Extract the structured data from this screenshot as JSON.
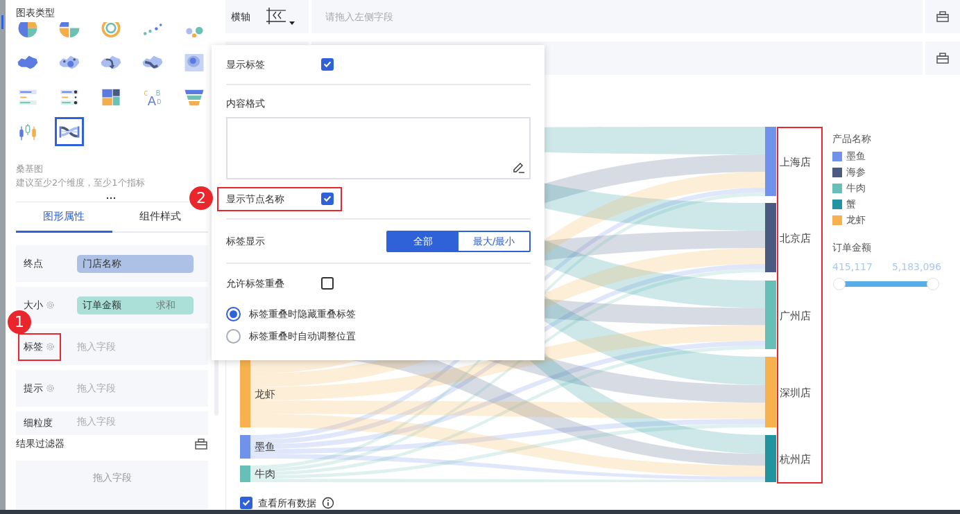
{
  "left_panel": {
    "title": "图表类型",
    "chart_types": [
      {
        "kind": "pie",
        "selected": false
      },
      {
        "kind": "half-pie",
        "selected": false
      },
      {
        "kind": "ring",
        "selected": false
      },
      {
        "kind": "dots",
        "selected": false
      },
      {
        "kind": "bubbles",
        "selected": false
      },
      {
        "kind": "map",
        "selected": false
      },
      {
        "kind": "bubble-map",
        "selected": false
      },
      {
        "kind": "flow-map",
        "selected": false
      },
      {
        "kind": "point-map",
        "selected": false
      },
      {
        "kind": "heat-map",
        "selected": false
      },
      {
        "kind": "rank-list",
        "selected": false
      },
      {
        "kind": "rank-dots",
        "selected": false
      },
      {
        "kind": "treemap",
        "selected": false
      },
      {
        "kind": "word-cloud",
        "letters": [
          "C",
          "A",
          "B",
          "D"
        ],
        "selected": false
      },
      {
        "kind": "funnel",
        "selected": false
      },
      {
        "kind": "candlestick",
        "selected": false
      },
      {
        "kind": "sankey",
        "selected": true
      }
    ],
    "chart_name": "桑基图",
    "chart_hint": "建议至少2个维度，至少1个指标",
    "tabs": [
      {
        "label": "图形属性",
        "selected": true
      },
      {
        "label": "组件样式",
        "selected": false
      }
    ],
    "fields": [
      {
        "label": "终点",
        "settings": false,
        "kind": "dimension",
        "value": "门店名称",
        "highlighted": false
      },
      {
        "label": "大小",
        "settings": true,
        "kind": "measure",
        "value": "订单金额",
        "aggregate": "求和",
        "highlighted": false
      },
      {
        "label": "标签",
        "settings": true,
        "kind": "empty",
        "placeholder": "拖入字段",
        "highlighted": true,
        "badge": "1"
      },
      {
        "label": "提示",
        "settings": true,
        "kind": "empty",
        "placeholder": "拖入字段",
        "highlighted": false
      },
      {
        "label": "细粒度",
        "settings": false,
        "kind": "empty",
        "placeholder": "拖入字段",
        "highlighted": false
      }
    ],
    "result_filter": {
      "title": "结果过滤器",
      "placeholder": "拖入字段"
    }
  },
  "axis_bar": {
    "label": "横轴",
    "placeholder": "请拖入左侧字段"
  },
  "chart": {
    "source_nodes": [
      {
        "label": "龙虾",
        "color": "#f7b24f"
      },
      {
        "label": "墨鱼",
        "color": "#7092ea"
      },
      {
        "label": "牛肉",
        "color": "#68bfb7"
      }
    ],
    "target_nodes": [
      {
        "label": "上海店",
        "color": "#7092ea"
      },
      {
        "label": "北京店",
        "color": "#4a5a80"
      },
      {
        "label": "广州店",
        "color": "#68bfb7"
      },
      {
        "label": "深圳店",
        "color": "#f7b24f"
      },
      {
        "label": "杭州店",
        "color": "#21949f"
      }
    ],
    "target_labels_highlighted": true,
    "legend": {
      "title": "产品名称",
      "items": [
        {
          "label": "墨鱼",
          "color": "#7092ea"
        },
        {
          "label": "海参",
          "color": "#4a5a80"
        },
        {
          "label": "牛肉",
          "color": "#68bfb7"
        },
        {
          "label": "蟹",
          "color": "#21949f"
        },
        {
          "label": "龙虾",
          "color": "#f7b24f"
        }
      ]
    },
    "size_legend": {
      "title": "订单金额",
      "min": "415,117",
      "max": "5,183,096",
      "level": 1
    },
    "view_all": {
      "label": "查看所有数据",
      "checked": true
    }
  },
  "popover": {
    "show_labels": {
      "label": "显示标签",
      "checked": true
    },
    "content_format": {
      "label": "内容格式"
    },
    "show_node_names": {
      "label": "显示节点名称",
      "checked": true,
      "highlighted": true,
      "badge": "2"
    },
    "label_display": {
      "label": "标签显示",
      "options": [
        {
          "label": "全部",
          "selected": true
        },
        {
          "label": "最大/最小",
          "selected": false
        }
      ]
    },
    "allow_overlap": {
      "label": "允许标签重叠",
      "checked": false
    },
    "overlap_options": [
      {
        "label": "标签重叠时隐藏重叠标签",
        "selected": true
      },
      {
        "label": "标签重叠时自动调整位置",
        "selected": false
      }
    ]
  }
}
